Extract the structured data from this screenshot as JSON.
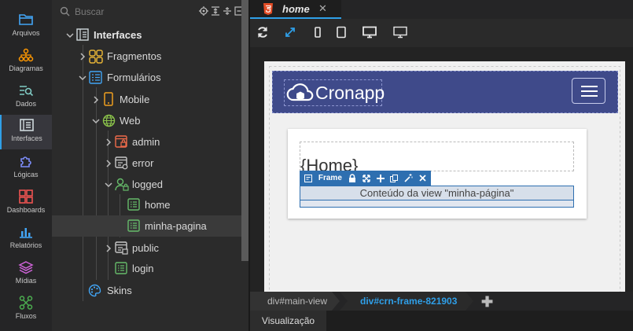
{
  "activity_bar": {
    "items": [
      {
        "label": "Arquivos",
        "icon": "folder-icon",
        "color": "#42a5f5"
      },
      {
        "label": "Diagramas",
        "icon": "diagram-icon",
        "color": "#ff9800"
      },
      {
        "label": "Dados",
        "icon": "data-icon",
        "color": "#80cbc4"
      },
      {
        "label": "Interfaces",
        "icon": "interfaces-icon",
        "color": "#cfd8dc",
        "active": true
      },
      {
        "label": "Lógicas",
        "icon": "puzzle-icon",
        "color": "#7c8cf8"
      },
      {
        "label": "Dashboards",
        "icon": "dashboard-icon",
        "color": "#ef5350"
      },
      {
        "label": "Relatórios",
        "icon": "reports-icon",
        "color": "#42a5f5"
      },
      {
        "label": "Mídias",
        "icon": "layers-icon",
        "color": "#ce63d8"
      },
      {
        "label": "Fluxos",
        "icon": "flow-icon",
        "color": "#4caf50"
      }
    ]
  },
  "search": {
    "placeholder": "Buscar"
  },
  "tree": {
    "root": "Interfaces",
    "fragmentos": "Fragmentos",
    "formularios": "Formulários",
    "mobile": "Mobile",
    "web": "Web",
    "admin": "admin",
    "error": "error",
    "logged": "logged",
    "home": "home",
    "minha_pagina": "minha-pagina",
    "public": "public",
    "login": "login",
    "skins": "Skins"
  },
  "editor": {
    "tab_title": "home",
    "brand": "Cronapp",
    "home_heading": "{Home}",
    "frame_label": "Frame",
    "frame_content": "Conteúdo da view \"minha-página\""
  },
  "breadcrumb": {
    "items": [
      "div#main-view",
      "div#crn-frame-821903"
    ]
  },
  "bottom": {
    "tab": "Visualização"
  }
}
